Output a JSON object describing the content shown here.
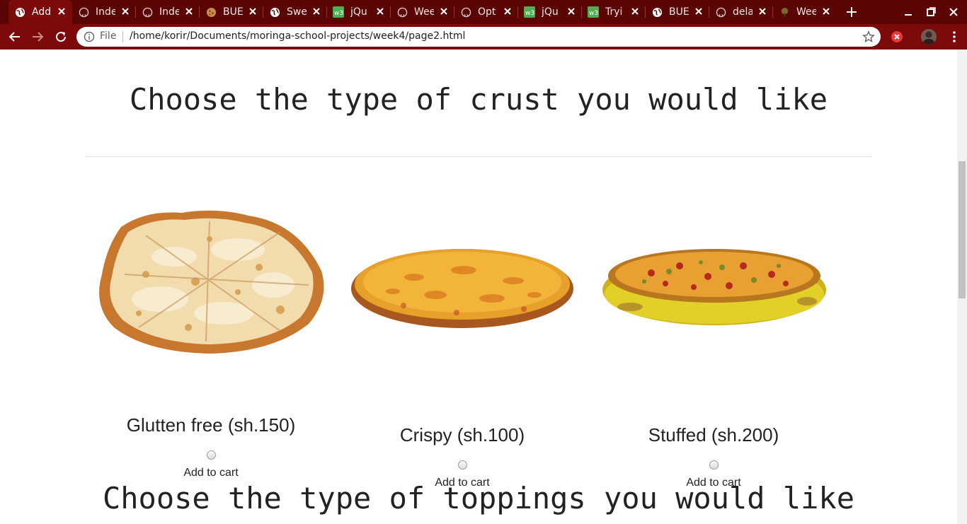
{
  "browser": {
    "tabs": [
      {
        "title": "Add",
        "icon": "globe-icon",
        "active": true
      },
      {
        "title": "Inde",
        "icon": "github-icon"
      },
      {
        "title": "Inde",
        "icon": "github-icon"
      },
      {
        "title": "BUE",
        "icon": "cookie-icon"
      },
      {
        "title": "Swe",
        "icon": "globe-icon"
      },
      {
        "title": "jQu",
        "icon": "w3schools-icon"
      },
      {
        "title": "Wee",
        "icon": "github-icon"
      },
      {
        "title": "Opt",
        "icon": "github-icon"
      },
      {
        "title": "jQu",
        "icon": "w3schools-icon"
      },
      {
        "title": "Tryi",
        "icon": "w3schools-icon"
      },
      {
        "title": "BUE",
        "icon": "globe-icon"
      },
      {
        "title": "dela",
        "icon": "github-icon"
      },
      {
        "title": "Wee",
        "icon": "tree-icon"
      }
    ],
    "address": {
      "scheme_label": "File",
      "url": "/home/korir/Documents/moringa-school-projects/week4/page2.html"
    },
    "colors": {
      "tabbar": "#5a0404",
      "toolbar": "#7d0a0a"
    }
  },
  "page": {
    "crust_heading": "Choose the type of crust you would like",
    "toppings_heading": "Choose the type of toppings you would like",
    "crusts": [
      {
        "label": "Glutten free (sh.150)",
        "cart_label": "Add to cart",
        "image": "pizza-gluten-free"
      },
      {
        "label": "Crispy (sh.100)",
        "cart_label": "Add to cart",
        "image": "pizza-crispy"
      },
      {
        "label": "Stuffed (sh.200)",
        "cart_label": "Add to cart",
        "image": "pizza-stuffed"
      }
    ]
  }
}
